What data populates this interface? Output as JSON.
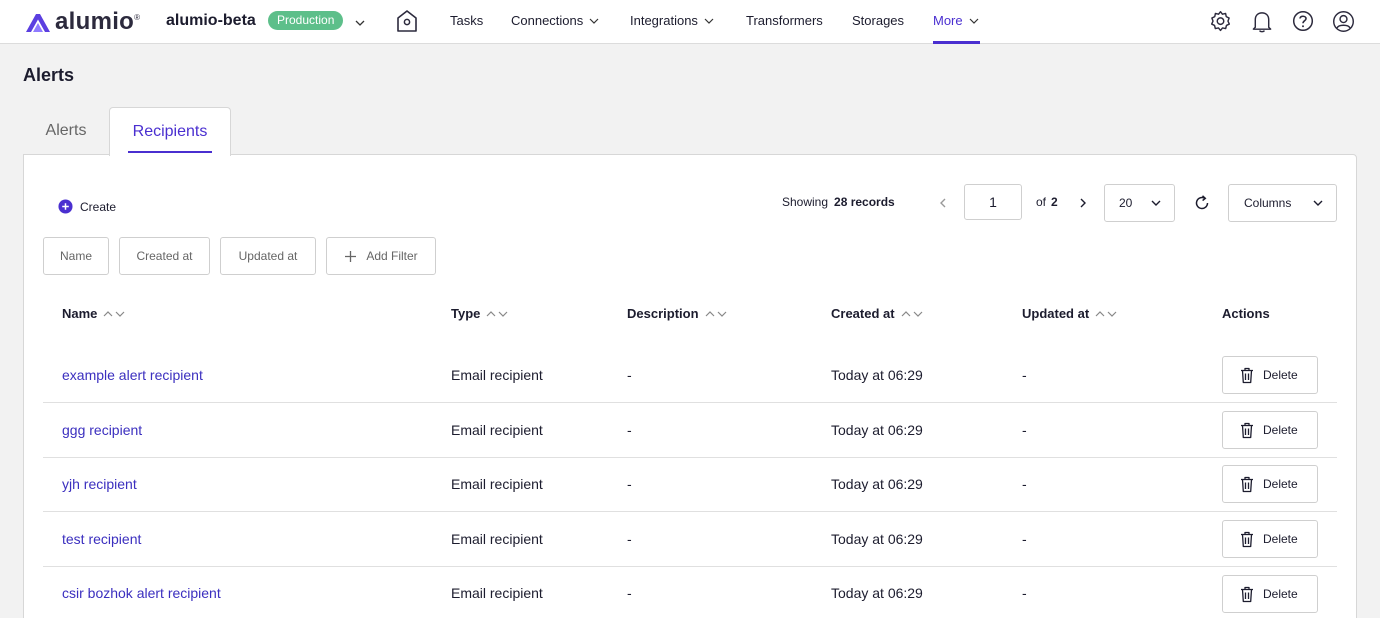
{
  "header": {
    "logo_text": "alumio",
    "logo_reg": "®",
    "project": "alumio-beta",
    "environment": "Production",
    "accent": "#4a2fd0",
    "env_color": "#5dbf8a",
    "nav": [
      {
        "label": "Tasks"
      },
      {
        "label": "Connections"
      },
      {
        "label": "Integrations"
      },
      {
        "label": "Transformers"
      },
      {
        "label": "Storages"
      },
      {
        "label": "More"
      }
    ],
    "icons": [
      "settings-icon",
      "bell-icon",
      "help-icon",
      "user-icon"
    ]
  },
  "page": {
    "title": "Alerts",
    "tabs": [
      {
        "label": "Alerts",
        "active": false
      },
      {
        "label": "Recipients",
        "active": true
      }
    ]
  },
  "toolbar": {
    "create_label": "Create",
    "showing_label": "Showing",
    "records_label": "28 records",
    "page_value": "1",
    "of_label": "of",
    "total_pages": "2",
    "per_page": "20",
    "columns_label": "Columns"
  },
  "filters": [
    {
      "label": "Name"
    },
    {
      "label": "Created at"
    },
    {
      "label": "Updated at"
    },
    {
      "label": "Add Filter"
    }
  ],
  "table": {
    "columns": [
      {
        "label": "Name"
      },
      {
        "label": "Type"
      },
      {
        "label": "Description"
      },
      {
        "label": "Created at"
      },
      {
        "label": "Updated at"
      },
      {
        "label": "Actions"
      }
    ],
    "delete_label": "Delete",
    "rows": [
      {
        "name": "example alert recipient",
        "type": "Email recipient",
        "description": "-",
        "created": "Today at 06:29",
        "updated": "-"
      },
      {
        "name": "ggg recipient",
        "type": "Email recipient",
        "description": "-",
        "created": "Today at 06:29",
        "updated": "-"
      },
      {
        "name": "yjh recipient",
        "type": "Email recipient",
        "description": "-",
        "created": "Today at 06:29",
        "updated": "-"
      },
      {
        "name": "test recipient",
        "type": "Email recipient",
        "description": "-",
        "created": "Today at 06:29",
        "updated": "-"
      },
      {
        "name": "csir bozhok alert recipient",
        "type": "Email recipient",
        "description": "-",
        "created": "Today at 06:29",
        "updated": "-"
      }
    ]
  }
}
